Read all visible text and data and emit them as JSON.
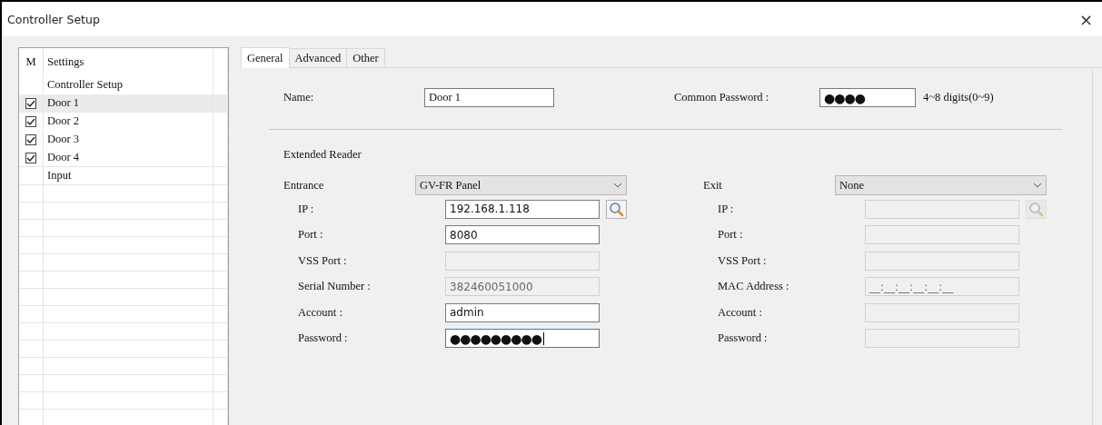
{
  "window": {
    "title": "Controller Setup",
    "close": "×"
  },
  "sidebar": {
    "columns": [
      "M",
      "Settings"
    ],
    "items": [
      {
        "label": "Controller Setup",
        "kind": "plain",
        "selected": false
      },
      {
        "label": "Door 1",
        "kind": "check",
        "checked": true,
        "selected": true
      },
      {
        "label": "Door 2",
        "kind": "check",
        "checked": true,
        "selected": false
      },
      {
        "label": "Door 3",
        "kind": "check",
        "checked": true,
        "selected": false
      },
      {
        "label": "Door 4",
        "kind": "check",
        "checked": true,
        "selected": false
      },
      {
        "label": "Input",
        "kind": "plain",
        "selected": false
      }
    ]
  },
  "tabs": [
    {
      "label": "General",
      "selected": true
    },
    {
      "label": "Advanced",
      "selected": false
    },
    {
      "label": "Other",
      "selected": false
    }
  ],
  "general": {
    "name": {
      "label": "Name:",
      "value": "Door 1"
    },
    "common_password": {
      "label": "Common Password :",
      "value": "●●●●",
      "hint": "4~8 digits(0~9)"
    }
  },
  "extended_reader": {
    "title": "Extended Reader",
    "readers": [
      {
        "label": "Entrance",
        "selection": "GV-FR Panel",
        "fields": [
          {
            "label": "IP :",
            "value": "192.168.1.118",
            "kind": "search",
            "disabled": false,
            "focused": false
          },
          {
            "label": "Port :",
            "value": "8080",
            "kind": "text",
            "disabled": false,
            "focused": false
          },
          {
            "label": "VSS Port :",
            "kind": "text",
            "disabled": true,
            "focused": false
          },
          {
            "label": "Serial Number :",
            "value": "382460051000",
            "kind": "text",
            "disabled": true,
            "focused": false
          },
          {
            "label": "Account :",
            "value": "admin",
            "kind": "text",
            "disabled": false,
            "focused": false
          },
          {
            "label": "Password :",
            "value": "●●●●●●●●●",
            "kind": "password",
            "disabled": false,
            "focused": true
          }
        ]
      },
      {
        "label": "Exit",
        "selection": "None",
        "fields": [
          {
            "label": "IP :",
            "kind": "search",
            "disabled": true,
            "focused": false
          },
          {
            "label": "Port :",
            "kind": "text",
            "disabled": true,
            "focused": false
          },
          {
            "label": "VSS Port :",
            "kind": "text",
            "disabled": true,
            "focused": false
          },
          {
            "label": "MAC Address :",
            "value": "__:__:__:__:__:__",
            "kind": "text",
            "disabled": true,
            "focused": false
          },
          {
            "label": "Account :",
            "kind": "text",
            "disabled": true,
            "focused": false
          },
          {
            "label": "Password :",
            "kind": "text",
            "disabled": true,
            "focused": false
          }
        ]
      }
    ]
  }
}
